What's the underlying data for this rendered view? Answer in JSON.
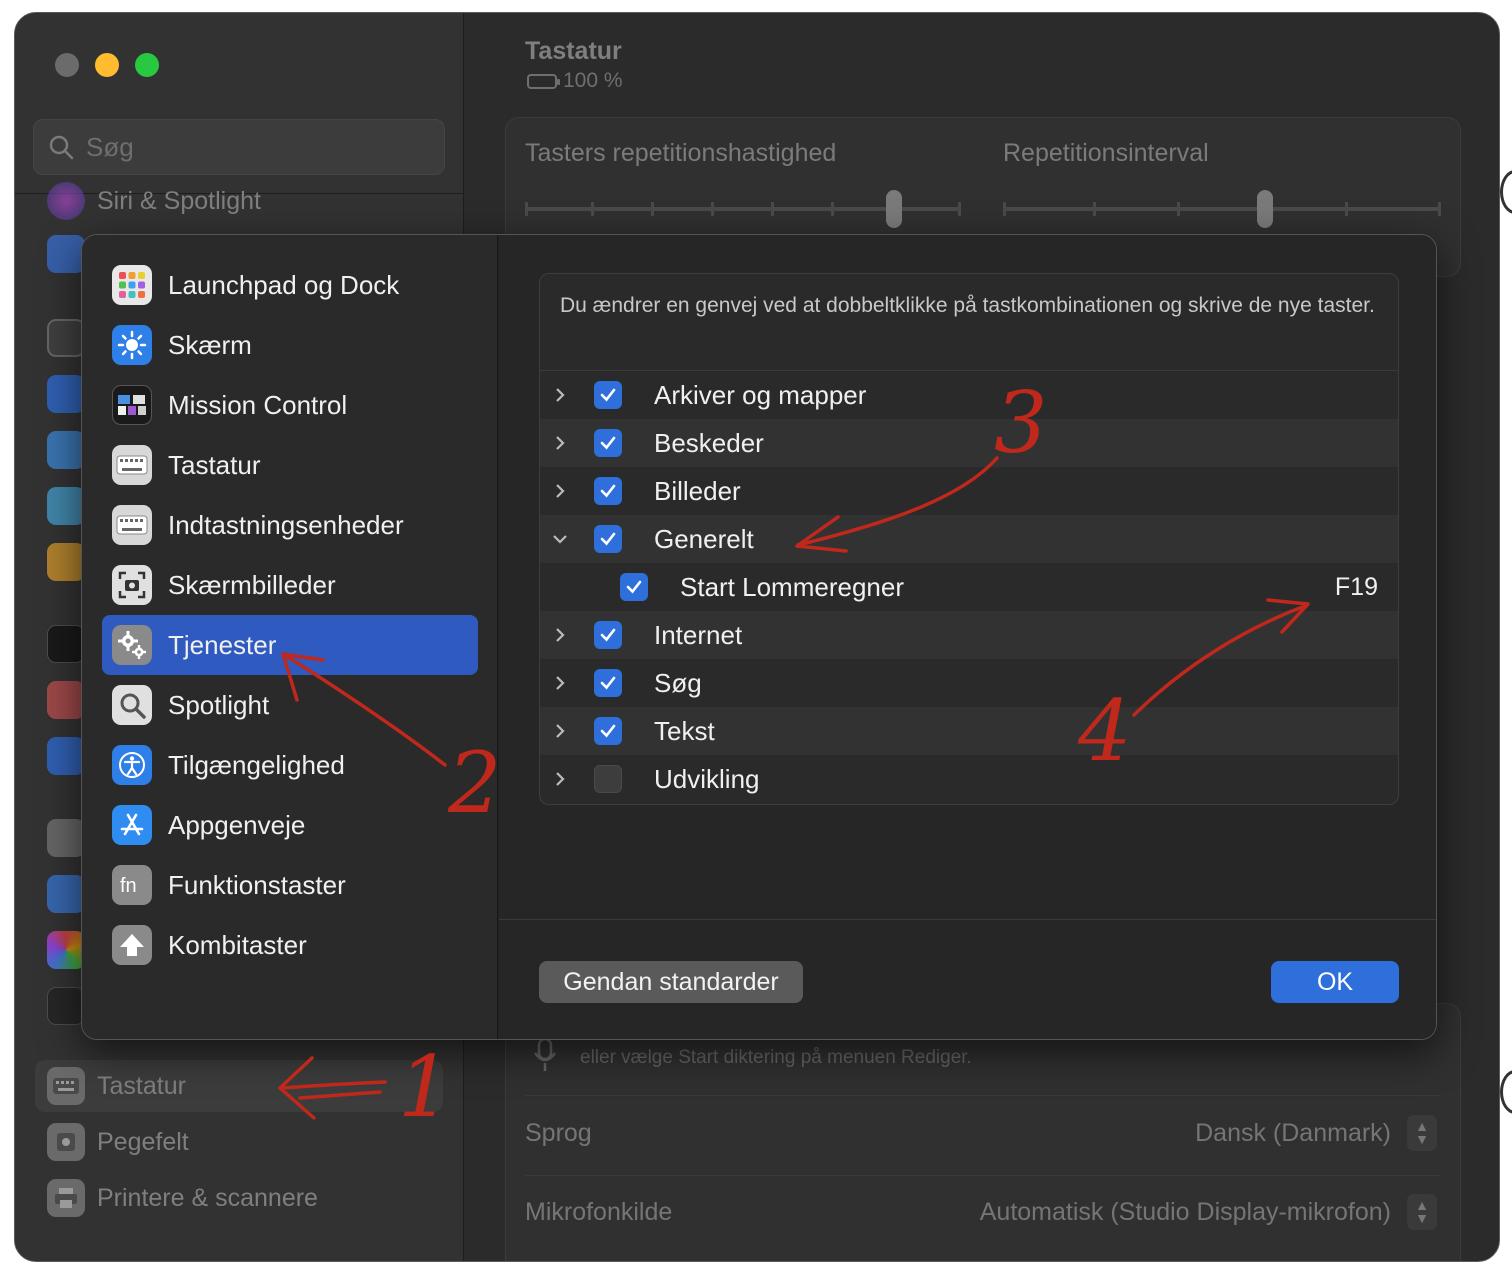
{
  "sidebar": {
    "search_placeholder": "Søg",
    "partial_item": "Siri & Spotlight",
    "bottom_items": [
      {
        "label": "Tastatur",
        "icon": "keyboard-icon"
      },
      {
        "label": "Pegefelt",
        "icon": "trackpad-icon"
      },
      {
        "label": "Printere & scannere",
        "icon": "printer-icon"
      }
    ]
  },
  "main": {
    "title": "Tastatur",
    "battery": "100 %",
    "slider1_label": "Tasters repetitionshastighed",
    "slider2_label": "Repetitionsinterval",
    "dictation_hint": "eller vælge Start diktering på menuen Rediger.",
    "language_label": "Sprog",
    "language_value": "Dansk (Danmark)",
    "mic_label": "Mikrofonkilde",
    "mic_value": "Automatisk (Studio Display-mikrofon)"
  },
  "modal": {
    "categories": [
      {
        "label": "Launchpad og Dock",
        "icon": "launchpad-icon"
      },
      {
        "label": "Skærm",
        "icon": "display-brightness-icon"
      },
      {
        "label": "Mission Control",
        "icon": "mission-control-icon"
      },
      {
        "label": "Tastatur",
        "icon": "keyboard-icon"
      },
      {
        "label": "Indtastningsenheder",
        "icon": "input-sources-icon"
      },
      {
        "label": "Skærmbilleder",
        "icon": "screenshot-icon"
      },
      {
        "label": "Tjenester",
        "icon": "gears-icon"
      },
      {
        "label": "Spotlight",
        "icon": "magnifier-icon"
      },
      {
        "label": "Tilgængelighed",
        "icon": "accessibility-icon"
      },
      {
        "label": "Appgenveje",
        "icon": "app-store-icon"
      },
      {
        "label": "Funktionstaster",
        "icon": "fn-key-icon"
      },
      {
        "label": "Kombitaster",
        "icon": "modifier-arrow-icon"
      }
    ],
    "active_category": "Tjenester",
    "info": "Du ændrer en genvej ved at dobbeltklikke på tastkombinationen og skrive de nye taster.",
    "rows": [
      {
        "label": "Arkiver og mapper",
        "checked": true,
        "expanded": false
      },
      {
        "label": "Beskeder",
        "checked": true,
        "expanded": false
      },
      {
        "label": "Billeder",
        "checked": true,
        "expanded": false
      },
      {
        "label": "Generelt",
        "checked": true,
        "expanded": true
      },
      {
        "label": "Start Lommeregner",
        "checked": true,
        "child": true,
        "key": "F19"
      },
      {
        "label": "Internet",
        "checked": true,
        "expanded": false
      },
      {
        "label": "Søg",
        "checked": true,
        "expanded": false
      },
      {
        "label": "Tekst",
        "checked": true,
        "expanded": false
      },
      {
        "label": "Udvikling",
        "checked": false,
        "expanded": false
      }
    ],
    "restore_button": "Gendan standarder",
    "ok_button": "OK"
  },
  "annotations": [
    "1",
    "2",
    "3",
    "4"
  ],
  "colors": {
    "accent": "#2f6fdb",
    "selection": "#2f5ac0",
    "annotation": "#c0281c"
  }
}
